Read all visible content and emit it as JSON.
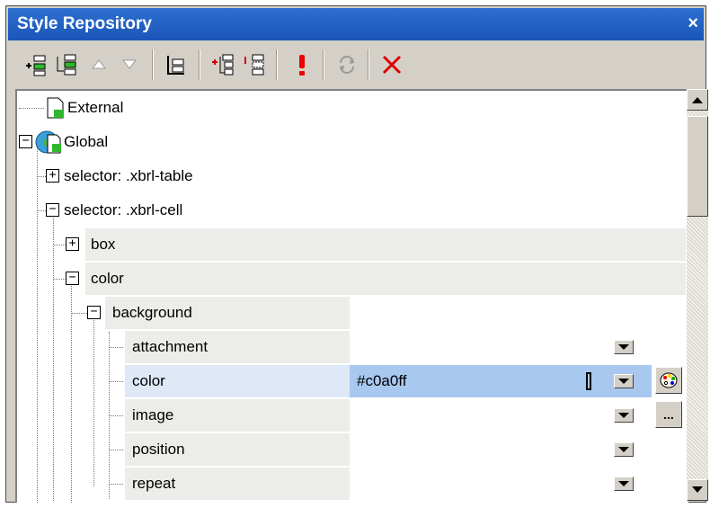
{
  "window": {
    "title": "Style Repository",
    "close_glyph": "×"
  },
  "toolbar": {
    "buttons": [
      {
        "name": "add-item-icon"
      },
      {
        "name": "insert-item-icon"
      },
      {
        "name": "move-up-icon"
      },
      {
        "name": "move-down-icon"
      },
      {
        "name": "toggle-layout-icon"
      },
      {
        "name": "add-child-icon"
      },
      {
        "name": "insert-child-icon"
      },
      {
        "name": "important-icon"
      },
      {
        "name": "reload-icon"
      },
      {
        "name": "delete-icon"
      }
    ]
  },
  "tree": {
    "external_label": "External",
    "global_label": "Global",
    "selector_table": "selector: .xbrl-table",
    "selector_cell": "selector: .xbrl-cell",
    "box_label": "box",
    "color_group_label": "color",
    "background_label": "background",
    "properties": [
      {
        "name": "attachment",
        "value": ""
      },
      {
        "name": "color",
        "value": "#c0a0ff"
      },
      {
        "name": "image",
        "value": ""
      },
      {
        "name": "position",
        "value": ""
      },
      {
        "name": "repeat",
        "value": ""
      }
    ],
    "ellipsis": "..."
  },
  "colors": {
    "title_bar": "#1a56b8",
    "selected_value": "#a8c8f0",
    "selected_row": "#dfe8f6"
  }
}
